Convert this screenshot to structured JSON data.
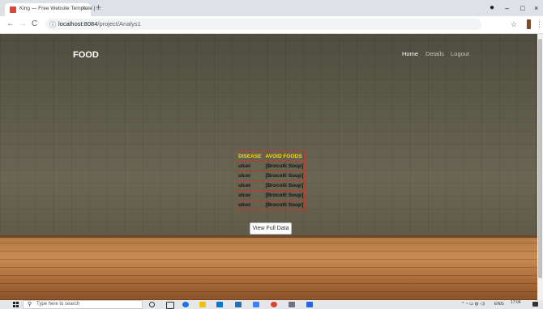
{
  "browser": {
    "tab_title": "King — Free Website Template | ...",
    "tab_close": "×",
    "new_tab": "+",
    "win_minimize": "–",
    "win_maximize": "□",
    "win_close": "×",
    "nav_back": "←",
    "nav_forward": "→",
    "nav_reload": "C",
    "url_host": "localhost:8084",
    "url_path": "/project/Analys1",
    "star_icon": "☆",
    "menu_icon": "⋮"
  },
  "site": {
    "brand": "FOOD",
    "nav": [
      "Home",
      "Details",
      "Logout"
    ]
  },
  "table": {
    "headers": [
      "DISEASE",
      "AVOID FOODS"
    ],
    "rows": [
      [
        "ulcer",
        "[Brocolli Soup]"
      ],
      [
        "ulcer",
        "[Brocolli Soup]"
      ],
      [
        "ulcer",
        "[Brocolli Soup]"
      ],
      [
        "ulcer",
        "[Brocolli Soup]"
      ],
      [
        "ulcer",
        "[Brocolli Soup]"
      ]
    ]
  },
  "button": {
    "view_full": "View Full Data"
  },
  "taskbar": {
    "search_placeholder": "Type here to search",
    "lang": "ENG",
    "time": "17:04"
  },
  "colors": {
    "table_border": "#c0392b",
    "table_header": "#ffd800",
    "wall": "#5f5a47",
    "floor": "#c98a52"
  }
}
